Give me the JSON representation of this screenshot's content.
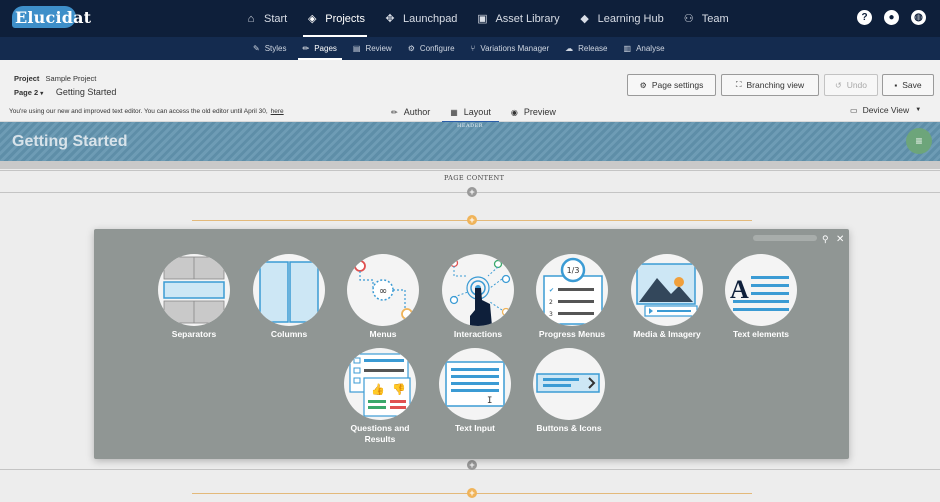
{
  "app": {
    "logo_text": "Elucidat"
  },
  "main_nav": [
    {
      "label": "Start",
      "icon": "home-icon"
    },
    {
      "label": "Projects",
      "icon": "layers-icon",
      "active": true
    },
    {
      "label": "Launchpad",
      "icon": "launchpad-icon"
    },
    {
      "label": "Asset Library",
      "icon": "image-icon"
    },
    {
      "label": "Learning Hub",
      "icon": "graduation-cap-icon"
    },
    {
      "label": "Team",
      "icon": "team-icon"
    }
  ],
  "top_icons": [
    "help-icon",
    "user-icon",
    "globe-icon"
  ],
  "sub_nav": [
    {
      "label": "Styles",
      "icon": "brush-icon"
    },
    {
      "label": "Pages",
      "icon": "pencil-icon",
      "active": true
    },
    {
      "label": "Review",
      "icon": "comment-icon"
    },
    {
      "label": "Configure",
      "icon": "gear-icon"
    },
    {
      "label": "Variations Manager",
      "icon": "variations-icon"
    },
    {
      "label": "Release",
      "icon": "cloud-upload-icon"
    },
    {
      "label": "Analyse",
      "icon": "bar-chart-icon"
    }
  ],
  "project": {
    "project_label": "Project",
    "project_name": "Sample Project",
    "page_label": "Page 2",
    "page_title": "Getting Started"
  },
  "notice": {
    "text": "You're using our new and improved text editor. You can access the old editor until April 30,",
    "link": "here"
  },
  "mode_tabs": [
    {
      "label": "Author",
      "icon": "pencil-icon"
    },
    {
      "label": "Layout",
      "icon": "grid-icon",
      "active": true
    },
    {
      "label": "Preview",
      "icon": "eye-icon"
    }
  ],
  "buttons": {
    "page_settings": "Page settings",
    "branching_view": "Branching view",
    "undo": "Undo",
    "save": "Save"
  },
  "device_view": "Device View",
  "banner": {
    "label": "HEADER",
    "title": "Getting Started"
  },
  "content": {
    "page_content_label": "PAGE CONTENT"
  },
  "modal": {
    "tiles": [
      "Separators",
      "Columns",
      "Menus",
      "Interactions",
      "Progress Menus",
      "Media & Imagery",
      "Text elements",
      "Questions and Results",
      "Text Input",
      "Buttons & Icons"
    ],
    "progress_fraction": "1/3"
  },
  "colors": {
    "top_nav": "#0e1f3a",
    "sub_nav": "#142b4f",
    "accent_blue": "#3b9bd4",
    "orange": "#f0b45a",
    "modal_bg": "#909694"
  }
}
